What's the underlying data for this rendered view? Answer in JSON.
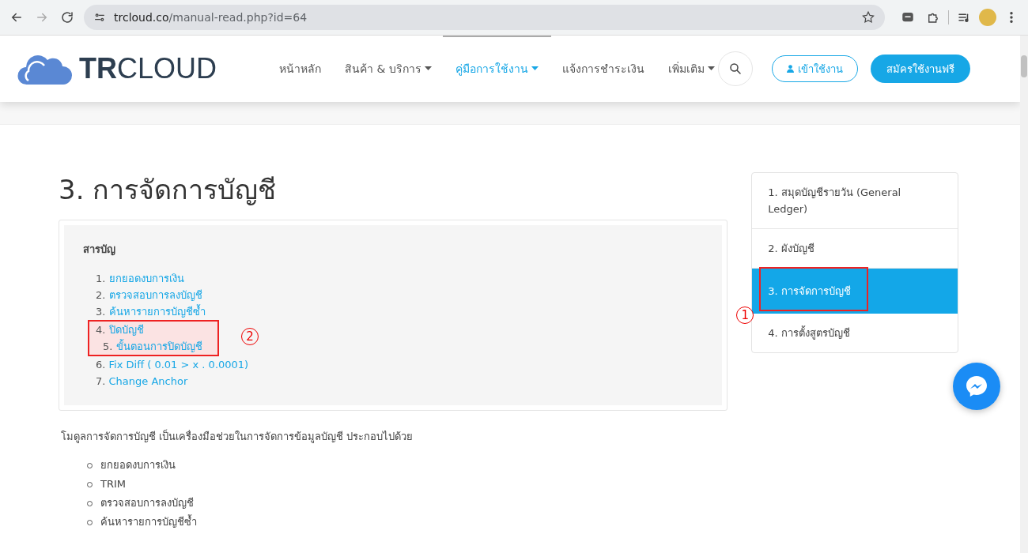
{
  "browser": {
    "url_host": "trcloud.co",
    "url_path": "/manual-read.php?id=64"
  },
  "header": {
    "logo": {
      "bold": "TR",
      "rest": "CLOUD"
    },
    "nav": [
      {
        "label": "หน้าหลัก",
        "dropdown": false,
        "selected": false
      },
      {
        "label": "สินค้า & บริการ",
        "dropdown": true,
        "selected": false
      },
      {
        "label": "คู่มือการใช้งาน",
        "dropdown": true,
        "selected": true
      },
      {
        "label": "แจ้งการชำระเงิน",
        "dropdown": false,
        "selected": false
      },
      {
        "label": "เพิ่มเติม",
        "dropdown": true,
        "selected": false
      }
    ],
    "login_button": "เข้าใช้งาน",
    "signup_button": "สมัครใช้งานฟรี"
  },
  "title": "3. การจัดการบัญชี",
  "toc": {
    "heading": "สารบัญ",
    "items": [
      {
        "number": "1.",
        "label": "ยกยอดงบการเงิน"
      },
      {
        "number": "2.",
        "label": "ตรวจสอบการลงบัญชี"
      },
      {
        "number": "3.",
        "label": "ค้นหารายการบัญชีซ้ำ"
      },
      {
        "number": "4.",
        "label": "ปิดบัญชี",
        "annotation": "2",
        "children": [
          {
            "number": "5.",
            "label": "ขั้นตอนการปิดบัญชี"
          }
        ]
      },
      {
        "number": "6.",
        "label": "Fix Diff ( 0.01 > x . 0.0001)"
      },
      {
        "number": "7.",
        "label": "Change Anchor"
      }
    ]
  },
  "intro": "โมดูลการจัดการบัญชี เป็นเครื่องมือช่วยในการจัดการข้อมูลบัญชี ประกอบไปด้วย",
  "bullets": [
    "ยกยอดงบการเงิน",
    "TRIM",
    "ตรวจสอบการลงบัญชี",
    "ค้นหารายการบัญชีซ้ำ"
  ],
  "sidebar": {
    "items": [
      {
        "label": "1. สมุดบัญชีรายวัน (General Ledger)",
        "selected": false
      },
      {
        "label": "2. ผังบัญชี",
        "selected": false
      },
      {
        "label": "3. การจัดการบัญชี",
        "selected": true,
        "annotation": "1"
      },
      {
        "label": "4. การตั้งสูตรบัญชี",
        "selected": false
      }
    ]
  }
}
